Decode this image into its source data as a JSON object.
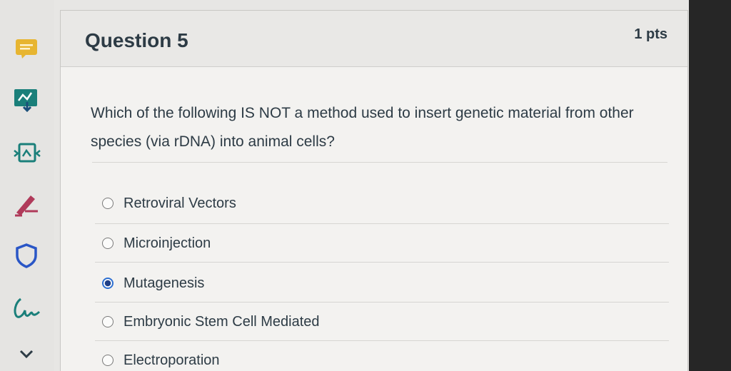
{
  "question": {
    "title": "Question 5",
    "points": "1 pts",
    "prompt": "Which of the following IS NOT a method used to insert genetic material from other species (via rDNA) into animal cells?"
  },
  "answers": [
    {
      "label": "Retroviral Vectors",
      "selected": false
    },
    {
      "label": "Microinjection",
      "selected": false
    },
    {
      "label": "Mutagenesis",
      "selected": true
    },
    {
      "label": "Embryonic Stem Cell Mediated",
      "selected": false
    },
    {
      "label": "Electroporation",
      "selected": false
    }
  ],
  "sidebar": {
    "icons": [
      "notes-icon",
      "import-icon",
      "commons-icon",
      "pencil-icon",
      "shield-icon",
      "handwriting-icon",
      "chevron-down-icon"
    ]
  },
  "colors": {
    "accent": "#2d6fd1",
    "text": "#2d3b45",
    "sidebar_icon": "#1a7f7a",
    "pencil_icon": "#b03a5a",
    "notes_icon": "#e7b531"
  }
}
